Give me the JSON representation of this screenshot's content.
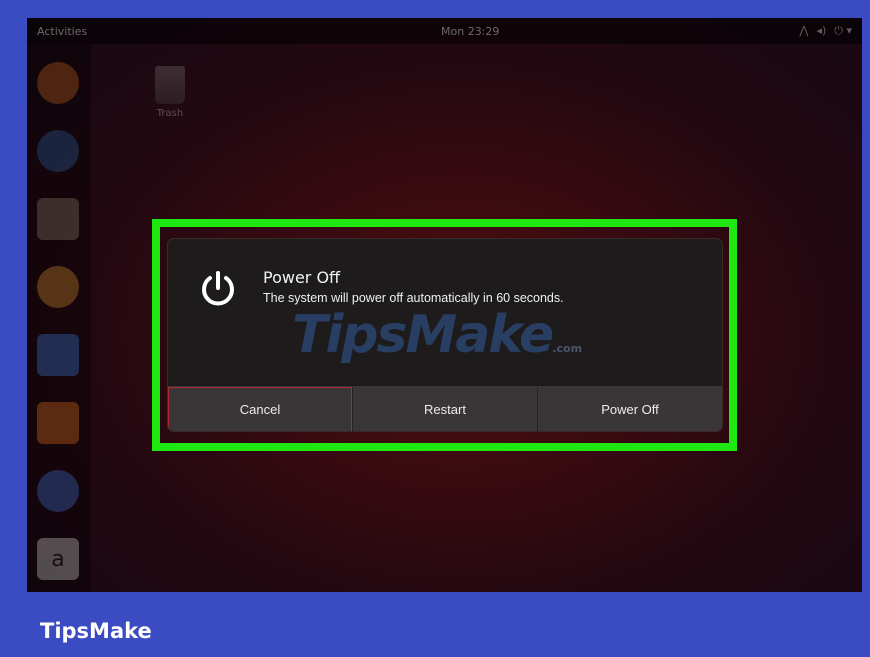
{
  "topbar": {
    "activities": "Activities",
    "clock": "Mon 23:29"
  },
  "desktop": {
    "trash_label": "Trash"
  },
  "dock": {
    "items": [
      "firefox-icon",
      "thunderbird-icon",
      "files-icon",
      "rhythmbox-icon",
      "writer-icon",
      "software-icon",
      "help-icon",
      "amazon-icon"
    ]
  },
  "dialog": {
    "title": "Power Off",
    "message": "The system will power off automatically in 60 seconds.",
    "buttons": {
      "cancel": "Cancel",
      "restart": "Restart",
      "power_off": "Power Off"
    }
  },
  "watermark": {
    "text": "TipsMake",
    "suffix": ".com"
  },
  "footer": {
    "brand": "TipsMake"
  },
  "colors": {
    "frame": "#3b4bc2",
    "highlight": "#1ee80f",
    "dialog_bg": "#1e1b1c",
    "button_bg": "#3a3637"
  }
}
